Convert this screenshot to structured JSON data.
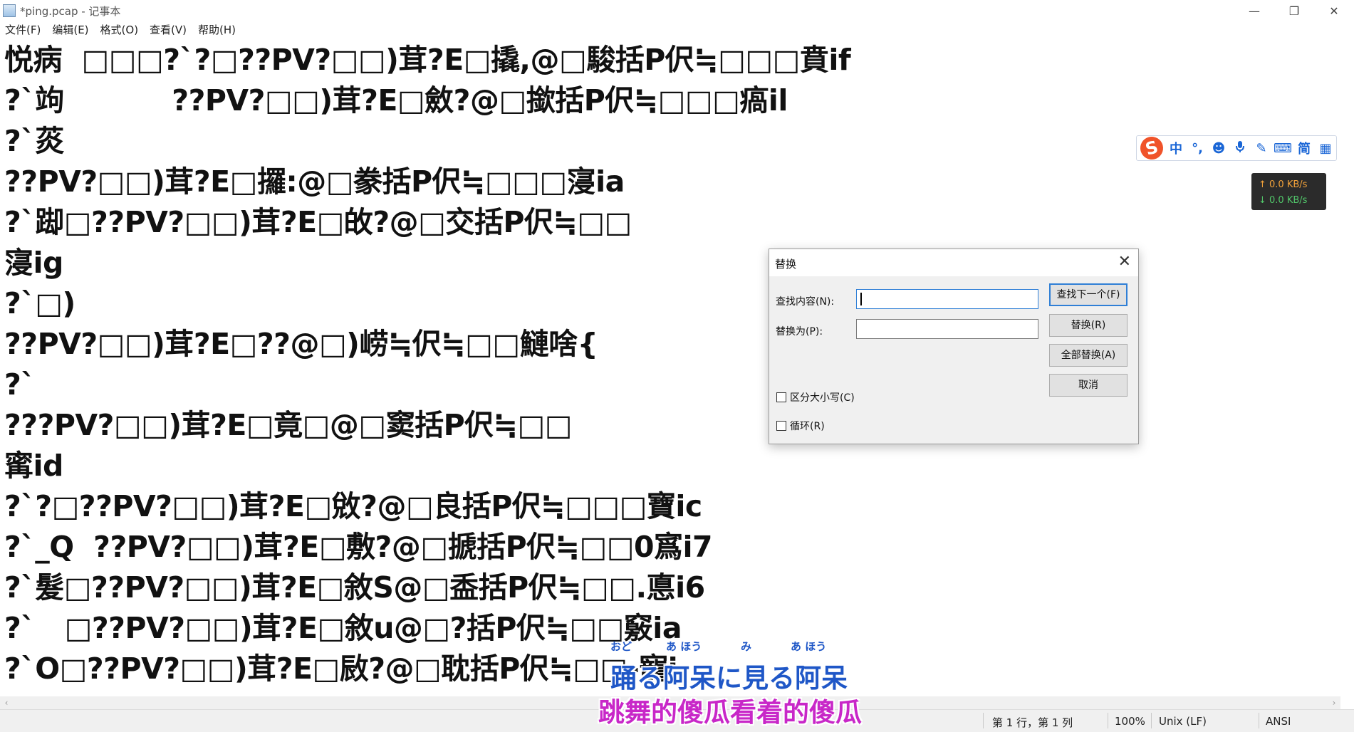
{
  "window": {
    "title": "*ping.pcap - 记事本",
    "controls": {
      "minimize": "—",
      "restore": "❐",
      "close": "✕"
    }
  },
  "menu": [
    "文件(F)",
    "编辑(E)",
    "格式(O)",
    "查看(V)",
    "帮助(H)"
  ],
  "editor_lines": [
    "悦病  □□□?`?□??PV?□□)茸?E□撬,@□駿括P伬≒□□□賁if",
    "?`竘           ??PV?□□)茸?E□斂?@□撳括P伬≒□□□瘑il",
    "?`菼",
    "??PV?□□)茸?E□攞:@□豢括P伬≒□□□寖ia",
    "?`踋□??PV?□□)茸?E□敀?@□交括P伬≒□□",
    "寖ig",
    "?`□)",
    "??PV?□□)茸?E□??@□)崂≒伬≒□□鰱啥{",
    "?`",
    "???PV?□□)茸?E□竟□@□窦括P伬≒□□",
    "寗id",
    "?`?□??PV?□□)茸?E□敓?@□良括P伬≒□□□寶ic",
    "?`_Q  ??PV?□□)茸?E□敷?@□搋括P伬≒□□0寪i7",
    "?`髮□??PV?□□)茸?E□敘S@□盉括P伬≒□□.悳i6",
    "?`   □??PV?□□)茸?E□敘u@□?括P伬≒□□竅ia",
    "?`O□??PV?□□)茸?E□敐?@□耽括P伬≒□□-寵i"
  ],
  "status_bar": {
    "position": "第 1 行，第 1 列",
    "zoom": "100%",
    "line_ending": "Unix (LF)",
    "encoding": "ANSI"
  },
  "ime_toolbar": {
    "logo": "S",
    "items": [
      {
        "label": "中",
        "icon": "chinese-mode-icon"
      },
      {
        "label": "°,",
        "icon": "punctuation-icon"
      },
      {
        "label": "☻",
        "icon": "emoji-icon"
      },
      {
        "label": "🎤",
        "icon": "microphone-icon"
      },
      {
        "label": "✎",
        "icon": "handwriting-icon"
      },
      {
        "label": "⌨",
        "icon": "keyboard-icon"
      },
      {
        "label": "简",
        "icon": "simplified-icon"
      },
      {
        "label": "▦",
        "icon": "grid-menu-icon"
      }
    ]
  },
  "net_speed": {
    "up": "↑ 0.0 KB/s",
    "down": "↓ 0.0 KB/s"
  },
  "replace_dialog": {
    "title": "替换",
    "find_label": "查找内容(N):",
    "find_value": "",
    "replace_label": "替换为(P):",
    "replace_value": "",
    "buttons": {
      "find_next": "查找下一个(F)",
      "replace": "替换(R)",
      "replace_all": "全部替换(A)",
      "cancel": "取消"
    },
    "options": {
      "match_case": {
        "label": "区分大小写(C)",
        "checked": false
      },
      "wrap": {
        "label": "循环(R)",
        "checked": false
      }
    }
  },
  "subtitles": {
    "japanese": "踊る阿呆に見る阿呆",
    "ruby": [
      "おど",
      "あ ほう",
      "み",
      "あ ほう"
    ],
    "chinese": "跳舞的傻瓜看着的傻瓜"
  },
  "colors": {
    "subtitle_blue": "#1f57c7",
    "subtitle_magenta": "#c827c8",
    "dialog_focus": "#2f7fd6",
    "net_up": "#f2a23a",
    "net_down": "#52c66a",
    "ime_brand": "#f0532a"
  }
}
